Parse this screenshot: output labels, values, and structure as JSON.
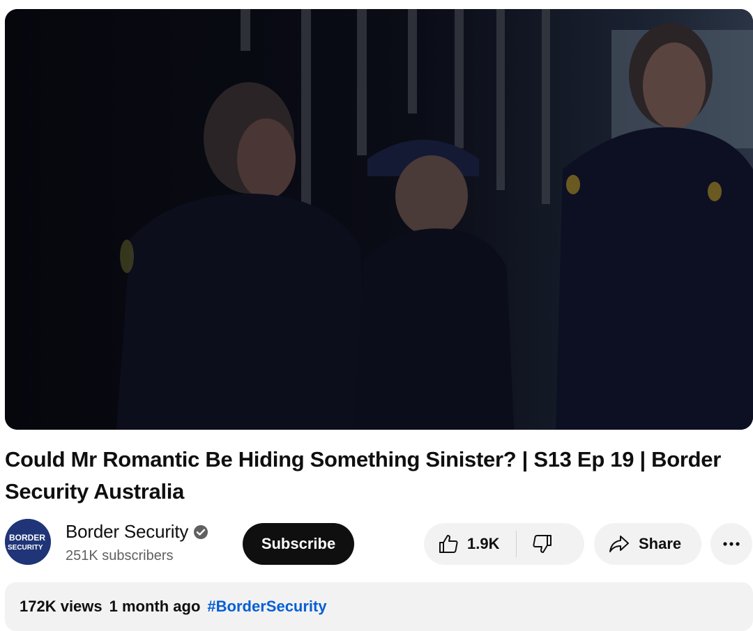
{
  "video": {
    "title": "Could Mr Romantic Be Hiding Something Sinister? | S13 Ep 19 | Border Security Australia"
  },
  "channel": {
    "name": "Border Security",
    "subscribers": "251K subscribers",
    "avatar_text_line1": "BORDER",
    "avatar_text_line2": "SECURITY",
    "verified_icon": "check-circle-icon"
  },
  "actions": {
    "subscribe_label": "Subscribe",
    "like_count": "1.9K",
    "share_label": "Share",
    "like_icon": "thumbs-up-icon",
    "dislike_icon": "thumbs-down-icon",
    "share_icon": "share-arrow-icon",
    "more_icon": "more-horizontal-icon"
  },
  "description": {
    "views": "172K views",
    "date": "1 month ago",
    "hashtag": "#BorderSecurity"
  },
  "colors": {
    "subscribe_bg": "#0f0f0f",
    "pill_bg": "#f2f2f2",
    "hashtag": "#065fd4",
    "avatar_bg": "#1f3577"
  }
}
